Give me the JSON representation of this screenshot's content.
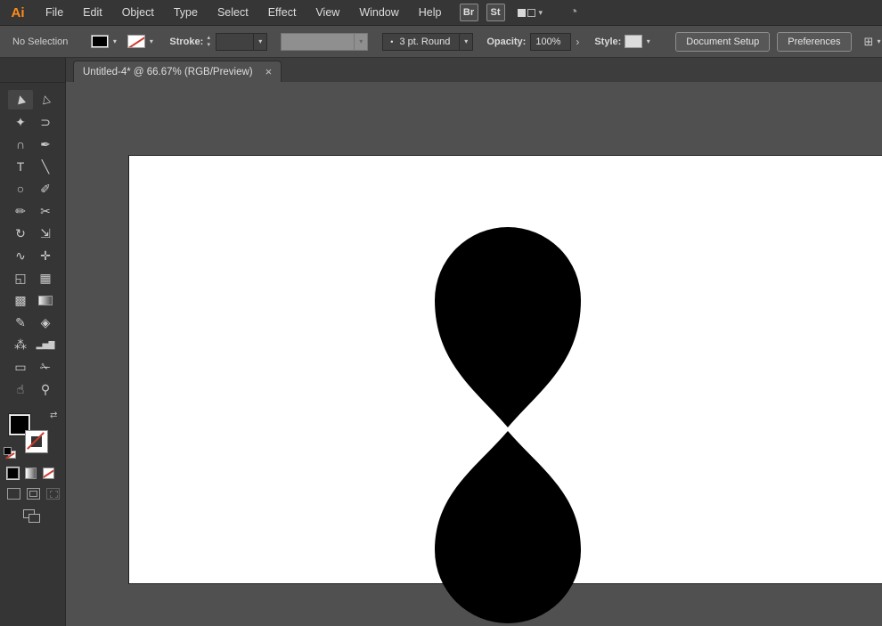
{
  "app": {
    "logo": "Ai"
  },
  "menubar": {
    "items": [
      "File",
      "Edit",
      "Object",
      "Type",
      "Select",
      "Effect",
      "View",
      "Window",
      "Help"
    ],
    "bridge_label": "Br",
    "stock_label": "St"
  },
  "controlbar": {
    "selection_status": "No Selection",
    "stroke_label": "Stroke:",
    "width_profile_value": "3 pt. Round",
    "opacity_label": "Opacity:",
    "opacity_value": "100%",
    "style_label": "Style:",
    "document_setup_label": "Document Setup",
    "preferences_label": "Preferences"
  },
  "tabbar": {
    "title": "Untitled-4* @ 66.67% (RGB/Preview)"
  },
  "toolbar": {
    "tools": [
      {
        "name": "selection-tool",
        "glyph": "▶"
      },
      {
        "name": "direct-selection-tool",
        "glyph": "▷"
      },
      {
        "name": "magic-wand-tool",
        "glyph": "✦"
      },
      {
        "name": "lasso-tool",
        "glyph": "⊃"
      },
      {
        "name": "curvature-tool",
        "glyph": "∩"
      },
      {
        "name": "pen-tool",
        "glyph": "✒"
      },
      {
        "name": "type-tool",
        "glyph": "T"
      },
      {
        "name": "line-segment-tool",
        "glyph": "╲"
      },
      {
        "name": "ellipse-tool",
        "glyph": "○"
      },
      {
        "name": "paintbrush-tool",
        "glyph": "✐"
      },
      {
        "name": "pencil-tool",
        "glyph": "✏"
      },
      {
        "name": "scissors-tool",
        "glyph": "✂"
      },
      {
        "name": "rotate-tool",
        "glyph": "↻"
      },
      {
        "name": "scale-tool",
        "glyph": "⇲"
      },
      {
        "name": "width-tool",
        "glyph": "∿"
      },
      {
        "name": "free-transform-tool",
        "glyph": "✛"
      },
      {
        "name": "shape-builder-tool",
        "glyph": "◱"
      },
      {
        "name": "perspective-grid-tool",
        "glyph": "▦"
      },
      {
        "name": "mesh-tool",
        "glyph": "▩"
      },
      {
        "name": "gradient-tool",
        "glyph": ""
      },
      {
        "name": "eyedropper-tool",
        "glyph": "✎"
      },
      {
        "name": "blend-tool",
        "glyph": "◈"
      },
      {
        "name": "symbol-sprayer-tool",
        "glyph": "⁂"
      },
      {
        "name": "column-graph-tool",
        "glyph": "▂▅▇"
      },
      {
        "name": "artboard-tool",
        "glyph": "▭"
      },
      {
        "name": "slice-tool",
        "glyph": "✁"
      },
      {
        "name": "hand-tool",
        "glyph": "☝"
      },
      {
        "name": "zoom-tool",
        "glyph": "⚲"
      }
    ]
  },
  "icons": {
    "chevron_down": "▾",
    "stepper_up": "▴",
    "stepper_down": "▾",
    "arrow_right": "›",
    "swap": "⇄",
    "collapse": "««",
    "close": "×",
    "dot": "•",
    "sync": "◔",
    "panel_glyph": "⊞"
  },
  "colors": {
    "fill": "#000000",
    "stroke_none": "#d03a2c",
    "logo": "#ff8c1a",
    "artboard": "#ffffff",
    "canvas": "#505050"
  }
}
